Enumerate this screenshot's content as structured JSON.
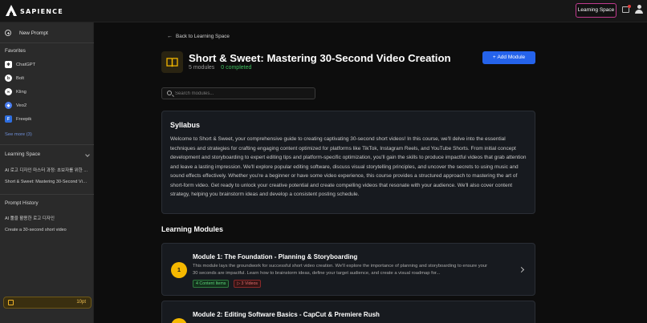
{
  "brand": {
    "name": "SAPIENCE"
  },
  "topbar": {
    "learning_space_label": "Learning Space"
  },
  "sidebar": {
    "new_prompt_label": "New Prompt",
    "favorites_heading": "Favorites",
    "favorites": [
      {
        "label": "ChatGPT",
        "icon": "chatgpt-icon",
        "color": "#ffffff"
      },
      {
        "label": "Bolt",
        "icon": "bolt-icon",
        "color": "#ffffff"
      },
      {
        "label": "Kling",
        "icon": "kling-icon",
        "color": "#ffffff"
      },
      {
        "label": "Veo2",
        "icon": "veo2-icon",
        "color": "#4a7ef0"
      },
      {
        "label": "Freepik",
        "icon": "freepik-icon",
        "color": "#2f6fe0"
      }
    ],
    "see_more_label": "See more (3)",
    "learning_space_heading": "Learning Space",
    "learning_items": [
      "AI 로고 디자인 마스터 과정: 초보자를 위한 ...",
      "Short & Sweet: Mastering 30-Second Vid..."
    ],
    "prompt_history_heading": "Prompt History",
    "history_items": [
      "AI 툴을 활용한 로고 디자인",
      "Create a 30-second short video"
    ],
    "credit_value": "10pt"
  },
  "main": {
    "back_label": "Back to Learning Space",
    "course_title": "Short & Sweet: Mastering 30-Second Video Creation",
    "module_count": "5 modules",
    "completed": "0 completed",
    "add_module_label": "Add Module",
    "search_placeholder": "Search modules...",
    "syllabus_heading": "Syllabus",
    "syllabus_text": "Welcome to Short & Sweet, your comprehensive guide to creating captivating 30-second short videos! In this course, we'll delve into the essential techniques and strategies for crafting engaging content optimized for platforms like TikTok, Instagram Reels, and YouTube Shorts. From initial concept development and storyboarding to expert editing tips and platform-specific optimization, you'll gain the skills to produce impactful videos that grab attention and leave a lasting impression. We'll explore popular editing software, discuss visual storytelling principles, and uncover the secrets to using music and sound effects effectively. Whether you're a beginner or have some video experience, this course provides a structured approach to mastering the art of short-form video. Get ready to unlock your creative potential and create compelling videos that resonate with your audience. We'll also cover content strategy, helping you brainstorm ideas and develop a consistent posting schedule.",
    "modules_heading": "Learning Modules",
    "modules": [
      {
        "number": "1",
        "title": "Module 1: The Foundation - Planning & Storyboarding",
        "description": "This module lays the groundwork for successful short video creation. We'll explore the importance of planning and storyboarding to ensure your 30 seconds are impactful. Learn how to brainstorm ideas, define your target audience, and create a visual roadmap for...",
        "content_badge": "4 Content Items",
        "video_badge": "▷ 3 Videos"
      },
      {
        "number": "2",
        "title": "Module 2: Editing Software Basics - CapCut & Premiere Rush",
        "description": ""
      }
    ]
  },
  "colors": {
    "accent": "#2563eb",
    "module_number": "#f5b800",
    "completed": "#3fbf5f",
    "learning_space_border": "#c23b8f"
  }
}
